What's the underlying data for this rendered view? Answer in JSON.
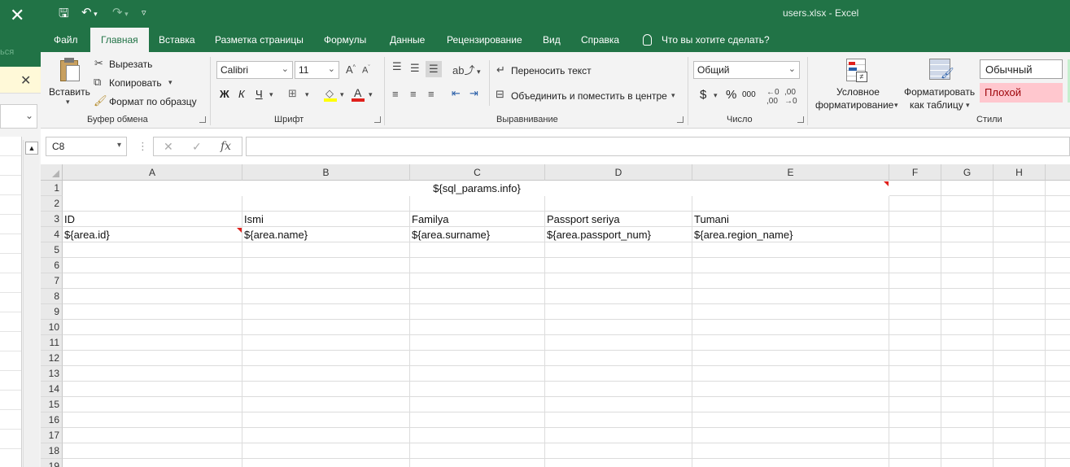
{
  "background_app": {
    "faint_text": "ься"
  },
  "titlebar": {
    "title": "users.xlsx  -  Excel"
  },
  "tabs": [
    "Файл",
    "Главная",
    "Вставка",
    "Разметка страницы",
    "Формулы",
    "Данные",
    "Рецензирование",
    "Вид",
    "Справка"
  ],
  "tell_me": "Что вы хотите сделать?",
  "clipboard": {
    "paste": "Вставить",
    "cut": "Вырезать",
    "copy": "Копировать",
    "format_painter": "Формат по образцу",
    "label": "Буфер обмена"
  },
  "font": {
    "name": "Calibri",
    "size": "11",
    "bold": "Ж",
    "italic": "К",
    "underline": "Ч",
    "label": "Шрифт"
  },
  "alignment": {
    "wrap_text": "Переносить текст",
    "merge_center": "Объединить и поместить в центре",
    "label": "Выравнивание"
  },
  "number": {
    "format": "Общий",
    "currency": "$",
    "percent": "%",
    "thousands": "000",
    "label": "Число"
  },
  "styles": {
    "conditional": [
      "Условное",
      "форматирование"
    ],
    "as_table": [
      "Форматировать",
      "как таблицу"
    ],
    "normal": "Обычный",
    "bad": "Плохой",
    "label": "Стили"
  },
  "formula_bar": {
    "name_box": "C8",
    "fx": "fx",
    "formula": ""
  },
  "columns": [
    "A",
    "B",
    "C",
    "D",
    "E",
    "F",
    "G",
    "H"
  ],
  "rows": [
    "1",
    "2",
    "3",
    "4",
    "5",
    "6",
    "7",
    "8",
    "9",
    "10",
    "11",
    "12",
    "13",
    "14",
    "15",
    "16",
    "17",
    "18",
    "19"
  ],
  "cells": {
    "merged_title": "${sql_params.info}",
    "headers": [
      "ID",
      "Ismi",
      "Familya",
      "Passport seriya",
      "Tumani"
    ],
    "row4": [
      "${area.id}",
      "${area.name}",
      "${area.surname}",
      "${area.passport_num}",
      "${area.region_name}"
    ]
  },
  "colors": {
    "excel_green": "#217346",
    "bad_fill": "#ffc7ce",
    "bad_text": "#9c0006",
    "comment_marker": "#e0201b"
  }
}
